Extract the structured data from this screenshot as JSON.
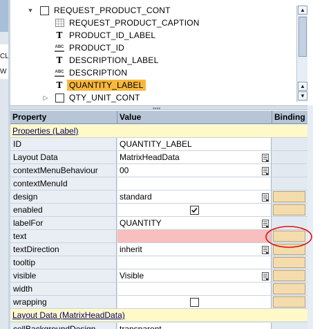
{
  "left_strip": {
    "snippet1": "CL",
    "snippet2": "W"
  },
  "tree": {
    "items": [
      {
        "label": "REQUEST_PRODUCT_CONT",
        "icon": "checkbox-icon",
        "expander": "down",
        "indent": 0,
        "selected": false
      },
      {
        "label": "REQUEST_PRODUCT_CAPTION",
        "icon": "caption-icon",
        "indent": 1,
        "selected": false
      },
      {
        "label": "PRODUCT_ID_LABEL",
        "icon": "text-icon",
        "indent": 1,
        "selected": false
      },
      {
        "label": "PRODUCT_ID",
        "icon": "input-field-icon",
        "indent": 1,
        "selected": false
      },
      {
        "label": "DESCRIPTION_LABEL",
        "icon": "text-icon",
        "indent": 1,
        "selected": false
      },
      {
        "label": "DESCRIPTION",
        "icon": "input-field-icon",
        "indent": 1,
        "selected": false
      },
      {
        "label": "QUANTITY_LABEL",
        "icon": "text-icon",
        "indent": 1,
        "selected": true
      },
      {
        "label": "QTY_UNIT_CONT",
        "icon": "checkbox-icon",
        "expander": "right",
        "indent": 0,
        "selected": false
      }
    ]
  },
  "properties": {
    "headers": {
      "property": "Property",
      "value": "Value",
      "binding": "Binding"
    },
    "section_label": "Properties (Label)",
    "rows": [
      {
        "name": "ID",
        "value": "QUANTITY_LABEL",
        "help": false,
        "binding": false
      },
      {
        "name": "Layout Data",
        "value": "MatrixHeadData",
        "help": true,
        "binding": false
      },
      {
        "name": "contextMenuBehaviour",
        "value": "00",
        "help": true,
        "binding": false
      },
      {
        "name": "contextMenuId",
        "value": "",
        "help": false,
        "binding": false
      },
      {
        "name": "design",
        "value": "standard",
        "help": true,
        "binding": true
      },
      {
        "name": "enabled",
        "value": "",
        "checkbox": true,
        "checked": true,
        "help": false,
        "binding": true
      },
      {
        "name": "labelFor",
        "value": "QUANTITY",
        "help": true,
        "binding": false
      },
      {
        "name": "text",
        "value": "",
        "pink": true,
        "help": false,
        "binding": true
      },
      {
        "name": "textDirection",
        "value": "inherit",
        "help": true,
        "binding": true
      },
      {
        "name": "tooltip",
        "value": "",
        "help": false,
        "binding": true
      },
      {
        "name": "visible",
        "value": "Visible",
        "help": true,
        "binding": true
      },
      {
        "name": "width",
        "value": "",
        "help": false,
        "binding": true
      },
      {
        "name": "wrapping",
        "value": "",
        "checkbox": true,
        "checked": false,
        "help": false,
        "binding": true
      }
    ],
    "section2_label": "Layout Data (MatrixHeadData)",
    "partial_row": {
      "name": "cellBackgroundDesign",
      "value": "transparent"
    }
  },
  "colors": {
    "selection": "#f7b83d",
    "binding_button": "#f4dcac",
    "required_field": "#f9bebe",
    "section_bg": "#fff9c8",
    "annotation": "#dd1111"
  }
}
